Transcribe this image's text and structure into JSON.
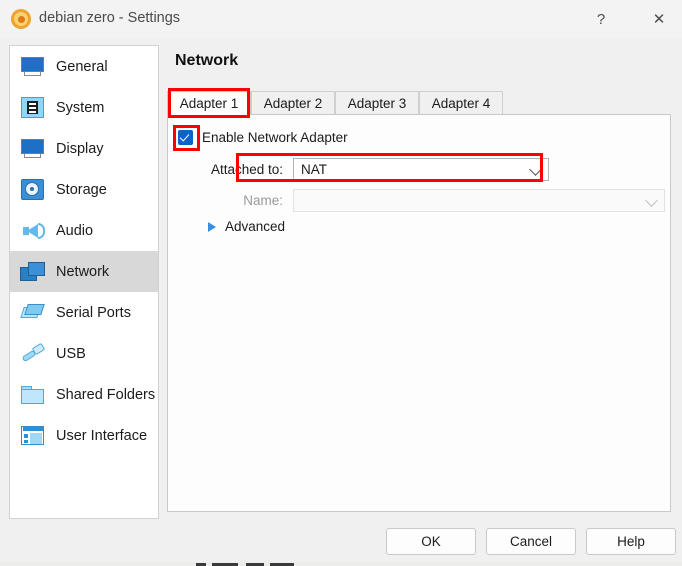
{
  "window": {
    "title": "debian zero - Settings",
    "app_icon": "virtualbox-gear-icon",
    "help_button": "?",
    "close_button": "✕"
  },
  "sidebar": {
    "items": [
      {
        "label": "General",
        "icon": "monitor-icon",
        "selected": false
      },
      {
        "label": "System",
        "icon": "cpu-chip-icon",
        "selected": false
      },
      {
        "label": "Display",
        "icon": "monitor-icon",
        "selected": false
      },
      {
        "label": "Storage",
        "icon": "hard-disk-icon",
        "selected": false
      },
      {
        "label": "Audio",
        "icon": "speaker-icon",
        "selected": false
      },
      {
        "label": "Network",
        "icon": "network-cards-icon",
        "selected": true
      },
      {
        "label": "Serial Ports",
        "icon": "serial-ports-icon",
        "selected": false
      },
      {
        "label": "USB",
        "icon": "usb-plug-icon",
        "selected": false
      },
      {
        "label": "Shared Folders",
        "icon": "folder-icon",
        "selected": false
      },
      {
        "label": "User Interface",
        "icon": "window-layout-icon",
        "selected": false
      }
    ]
  },
  "main": {
    "page_title": "Network",
    "tabs": [
      {
        "label": "Adapter 1",
        "active": true
      },
      {
        "label": "Adapter 2",
        "active": false
      },
      {
        "label": "Adapter 3",
        "active": false
      },
      {
        "label": "Adapter 4",
        "active": false
      }
    ],
    "enable_adapter": {
      "label": "Enable Network Adapter",
      "checked": true
    },
    "attached_to": {
      "label": "Attached to:",
      "value": "NAT",
      "enabled": true,
      "dropdown_icon": "chevron-down-icon"
    },
    "name_field": {
      "label": "Name:",
      "value": "",
      "enabled": false,
      "dropdown_icon": "chevron-down-icon"
    },
    "advanced": {
      "label": "Advanced",
      "expander_icon": "triangle-right-icon",
      "expanded": false
    }
  },
  "footer": {
    "ok": "OK",
    "cancel": "Cancel",
    "help": "Help"
  },
  "colors": {
    "annotation": "#FE0000",
    "checkbox_blue": "#0A64C8",
    "selection_gray": "#D8D8D8",
    "accent_blue": "#3A8FE0"
  }
}
